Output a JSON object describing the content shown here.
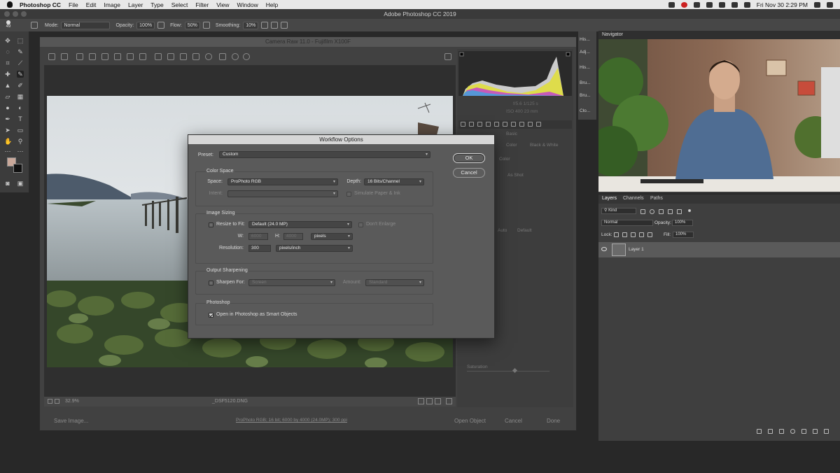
{
  "menubar": {
    "app_name": "Photoshop CC",
    "items": [
      "File",
      "Edit",
      "Image",
      "Layer",
      "Type",
      "Select",
      "Filter",
      "View",
      "Window",
      "Help"
    ],
    "clock": "Fri Nov 30  2:29 PM"
  },
  "window_title": "Adobe Photoshop CC 2019",
  "options_bar": {
    "brush_size": "49",
    "mode_label": "Mode:",
    "mode_value": "Normal",
    "opacity_label": "Opacity:",
    "opacity_value": "100%",
    "flow_label": "Flow:",
    "flow_value": "50%",
    "smoothing_label": "Smoothing:",
    "smoothing_value": "10%"
  },
  "camera_raw": {
    "title": "Camera Raw 11.0  -  Fujifilm X100F",
    "zoom": "32.9%",
    "filename": "_DSF5120.DNG",
    "save_image": "Save Image...",
    "workflow_link": "ProPhoto RGB; 16 bit; 6000 by 4000 (24.0MP); 300 ppi",
    "open_object": "Open Object",
    "cancel": "Cancel",
    "done": "Done",
    "exif": {
      "aperture_shutter": "f/5.6   1/125 s",
      "iso_focal": "ISO 400   23 mm"
    },
    "panel_labels": {
      "basic": "Basic",
      "color": "Color",
      "black_white": "Black & White",
      "profile": "Color",
      "white_balance": "As Shot",
      "auto": "Auto",
      "default": "Default",
      "saturation": "Saturation"
    }
  },
  "dialog": {
    "title": "Workflow Options",
    "preset_label": "Preset:",
    "preset_value": "Custom",
    "ok": "OK",
    "cancel": "Cancel",
    "color_space": {
      "heading": "Color Space",
      "space_label": "Space:",
      "space_value": "ProPhoto RGB",
      "depth_label": "Depth:",
      "depth_value": "16 Bits/Channel",
      "intent_label": "Intent:",
      "simulate_label": "Simulate Paper & Ink"
    },
    "image_sizing": {
      "heading": "Image Sizing",
      "resize_label": "Resize to Fit:",
      "resize_value": "Default  (24.0 MP)",
      "dont_enlarge": "Don't Enlarge",
      "w_label": "W:",
      "w_value": "6000",
      "h_label": "H:",
      "h_value": "4000",
      "units_value": "pixels",
      "resolution_label": "Resolution:",
      "resolution_value": "300",
      "resolution_units": "pixels/inch"
    },
    "output_sharpening": {
      "heading": "Output Sharpening",
      "sharpen_label": "Sharpen For:",
      "sharpen_value": "Screen",
      "amount_label": "Amount:",
      "amount_value": "Standard"
    },
    "photoshop": {
      "heading": "Photoshop",
      "smart_objects_label": "Open in Photoshop as Smart Objects",
      "smart_objects_checked": true
    }
  },
  "mini_panels": [
    "His...",
    "Adj...",
    "His...",
    "Bru...",
    "Bru...",
    "Clo..."
  ],
  "navigator": {
    "title": "Navigator"
  },
  "layers_panel": {
    "tabs": [
      "Layers",
      "Channels",
      "Paths"
    ],
    "kind_label": "Kind",
    "blend_mode": "Normal",
    "opacity_label": "Opacity:",
    "opacity_value": "100%",
    "lock_label": "Lock:",
    "fill_label": "Fill:",
    "fill_value": "100%",
    "layers": [
      {
        "name": "Layer 1"
      }
    ]
  },
  "colors": {
    "dialog_bg": "#5a5a5a",
    "panel_bg": "#3f3f3f",
    "foreground_swatch": "#c9a89a",
    "background_swatch": "#111111"
  }
}
